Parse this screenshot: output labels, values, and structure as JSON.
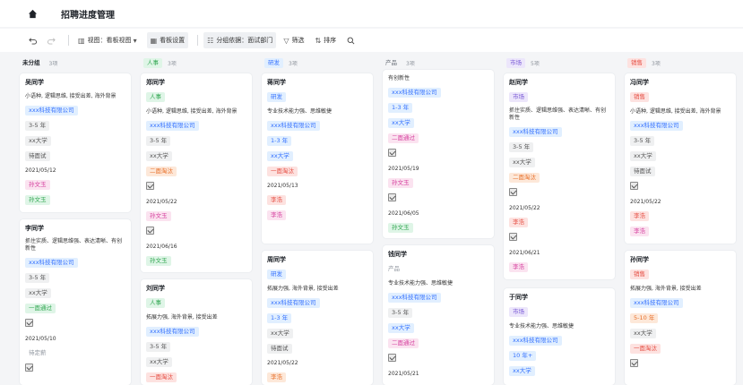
{
  "app": {
    "title": "招聘进度管理"
  },
  "toolbar": {
    "view_label": "视图：看板视图",
    "board_settings": "看板设置",
    "group_by": "分组依据：面试部门",
    "filter": "筛选",
    "sort": "排序"
  },
  "colors": {
    "accent": "#3370ff"
  },
  "columns": [
    {
      "label": "未分组",
      "count": "3项",
      "color": "#ffffff"
    },
    {
      "label": "人事",
      "count": "3项",
      "color": "#dff5e7"
    },
    {
      "label": "研发",
      "count": "3项",
      "color": "#e1efff"
    },
    {
      "label": "产品",
      "count": "3项",
      "color": "#ffffff"
    },
    {
      "label": "市场",
      "count": "5项",
      "color": "#ece6fb"
    },
    {
      "label": "销售",
      "count": "3项",
      "color": "#fde2e0"
    }
  ],
  "cards": {
    "c0a": {
      "name": "吴同学",
      "desc": "小语种, 逻辑思维, 接受出差, 海外背景",
      "company": "xxx科技有限公司",
      "exp": "3-5 年",
      "school": "xx大学",
      "stage": "待面试",
      "date": "2021/05/12",
      "t1": "孙文玉",
      "t2": "孙文玉"
    },
    "c0b": {
      "name": "李同学",
      "desc": "抓住实质、逻辑思维强、表达清晰、有创新性",
      "company": "xxx科技有限公司",
      "exp": "3-5 年",
      "school": "xx大学",
      "stage": "一面通过",
      "date": "2021/05/10",
      "t1": "待定薪"
    },
    "c1a": {
      "name": "郑同学",
      "dept": "人事",
      "desc": "小语种, 逻辑思维, 接受出差, 海外背景",
      "company": "xxx科技有限公司",
      "exp": "3-5 年",
      "school": "xx大学",
      "stage": "二面淘汰",
      "date": "2021/05/22",
      "t1": "孙文玉",
      "date2": "2021/06/16",
      "t2": "孙文玉"
    },
    "c1b": {
      "name": "刘同学",
      "dept": "人事",
      "desc": "拓展力强, 海外背景, 接受出差",
      "company": "xxx科技有限公司",
      "exp": "3-5 年",
      "school": "xx大学",
      "stage": "一面淘汰"
    },
    "c2a": {
      "name": "蒋同学",
      "dept": "研发",
      "desc": "专业技术能力强、思维敏捷",
      "company": "xxx科技有限公司",
      "exp": "1-3 年",
      "school": "xx大学",
      "stage": "一面淘汰",
      "date": "2021/05/13",
      "t1": "李浩",
      "t2": "李浩"
    },
    "c2b": {
      "name": "周同学",
      "dept": "研发",
      "desc": "拓展力强, 海外背景, 接受出差",
      "company": "xxx科技有限公司",
      "exp": "1-3 年",
      "school": "xx大学",
      "stage": "待面试",
      "date": "2021/05/22",
      "t1": "李浩"
    },
    "c3a": {
      "desc": "有创新性",
      "company": "xxx科技有限公司",
      "exp": "1-3 年",
      "school": "xx大学",
      "stage": "二面通过",
      "date": "2021/05/19",
      "t1": "孙文玉",
      "date2": "2021/06/05",
      "t2": "孙文玉"
    },
    "c3b": {
      "name": "钱同学",
      "dept": "产品",
      "desc": "专业技术能力强、思维敏捷",
      "company": "xxx科技有限公司",
      "exp": "3-5 年",
      "school": "xx大学",
      "stage": "二面通过",
      "date": "2021/05/21"
    },
    "c4a": {
      "name": "赵同学",
      "dept": "市场",
      "desc": "抓住实质、逻辑思维强、表达清晰、有创新性",
      "company": "xxx科技有限公司",
      "exp": "3-5 年",
      "school": "xx大学",
      "stage": "二面淘汰",
      "date": "2021/05/22",
      "t1": "李浩",
      "date2": "2021/06/21",
      "t2": "李浩"
    },
    "c4b": {
      "name": "于同学",
      "dept": "市场",
      "desc": "专业技术能力强、思维敏捷",
      "company": "xxx科技有限公司",
      "exp": "10 年+",
      "school": "xx大学"
    },
    "c5a": {
      "name": "冯同学",
      "dept": "销售",
      "desc": "小语种, 逻辑思维, 接受出差, 海外背景",
      "company": "xxx科技有限公司",
      "exp": "3-5 年",
      "school": "xx大学",
      "stage": "待面试",
      "date": "2021/05/22",
      "t1": "李浩",
      "t2": "李浩"
    },
    "c5b": {
      "name": "孙同学",
      "dept": "销售",
      "desc": "拓展力强, 海外背景, 接受出差",
      "company": "xxx科技有限公司",
      "exp": "5-10 年",
      "school": "xx大学",
      "stage": "一面淘汰"
    }
  }
}
